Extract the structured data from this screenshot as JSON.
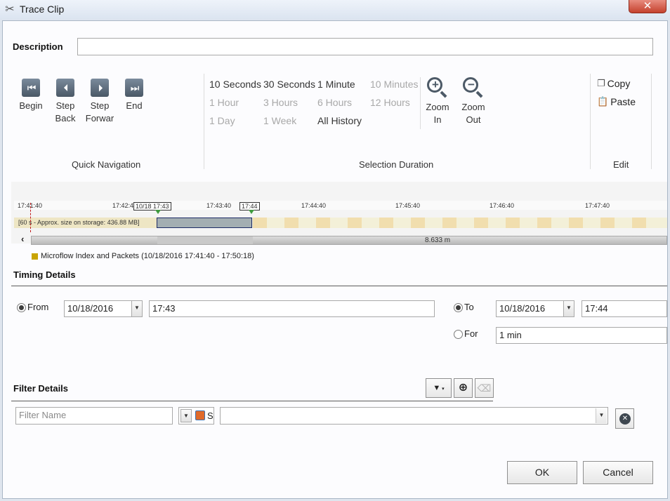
{
  "window": {
    "title": "Trace Clip",
    "close_symbol": "✕"
  },
  "description": {
    "label": "Description",
    "value": ""
  },
  "quick_navigation": {
    "group_label": "Quick Navigation",
    "buttons": [
      {
        "line1": "Begin",
        "line2": ""
      },
      {
        "line1": "Step",
        "line2": "Back"
      },
      {
        "line1": "Step",
        "line2": "Forwar"
      },
      {
        "line1": "End",
        "line2": ""
      }
    ]
  },
  "selection_duration": {
    "group_label": "Selection Duration",
    "options": [
      {
        "label": "10 Seconds",
        "enabled": true
      },
      {
        "label": "30 Seconds",
        "enabled": true
      },
      {
        "label": "1 Minute",
        "enabled": true
      },
      {
        "label": "10 Minutes",
        "enabled": false
      },
      {
        "label": "1 Hour",
        "enabled": false
      },
      {
        "label": "3 Hours",
        "enabled": false
      },
      {
        "label": "6 Hours",
        "enabled": false
      },
      {
        "label": "12 Hours",
        "enabled": false
      },
      {
        "label": "1 Day",
        "enabled": false
      },
      {
        "label": "1 Week",
        "enabled": false
      },
      {
        "label": "All History",
        "enabled": true
      }
    ],
    "zoom_in": {
      "line1": "Zoom",
      "line2": "In"
    },
    "zoom_out": {
      "line1": "Zoom",
      "line2": "Out"
    }
  },
  "edit": {
    "group_label": "Edit",
    "copy": "Copy",
    "paste": "Paste"
  },
  "timeline": {
    "ticks": [
      "17:41:40",
      "17:42:4",
      "10/18 17:43",
      "17:43:40",
      "17:44",
      "17:44:40",
      "17:45:40",
      "17:46:40",
      "17:47:40"
    ],
    "row_label": "[60 s - Approx. size on storage: 436.88 MB]",
    "scroll_left": "‹",
    "span_text": "8.633 m",
    "legend_text": "Microflow Index and Packets (10/18/2016 17:41:40 - 17:50:18)",
    "legend_color": "#c8a400"
  },
  "timing_details": {
    "heading": "Timing Details",
    "from": {
      "label": "From",
      "date": "10/18/2016",
      "time": "17:43"
    },
    "to": {
      "label": "To",
      "date": "10/18/2016",
      "time": "17:44"
    },
    "for": {
      "label": "For",
      "value": "1 min"
    },
    "combo_arrow": "▼"
  },
  "filter_details": {
    "heading": "Filter Details",
    "filter_name_placeholder": "Filter Name",
    "scope_text": "S",
    "value": ""
  },
  "buttons": {
    "ok": "OK",
    "cancel": "Cancel"
  }
}
